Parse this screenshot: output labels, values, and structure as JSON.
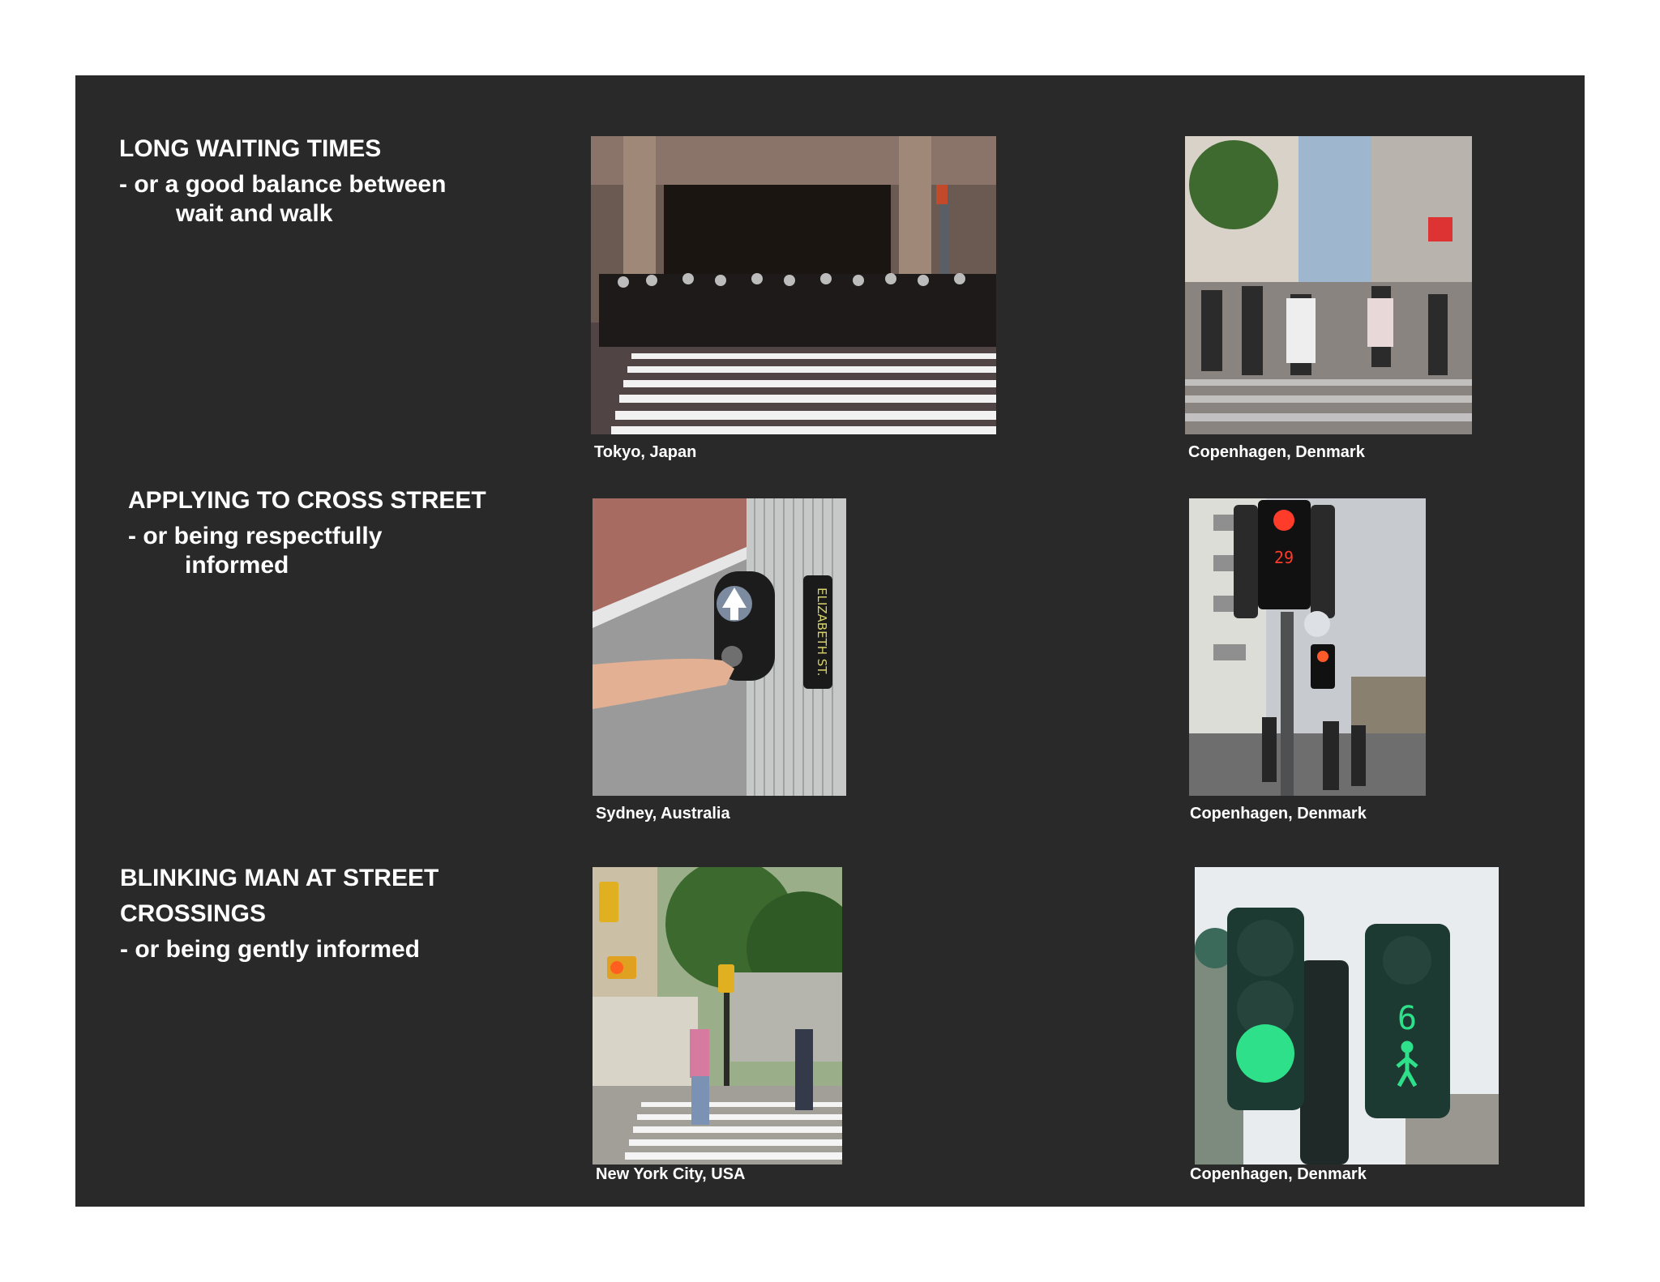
{
  "sections": [
    {
      "title": "LONG WAITING TIMES",
      "line1": "- or a good balance between",
      "line2": "wait and walk"
    },
    {
      "title": "APPLYING TO CROSS STREET",
      "line1": "- or being respectfully",
      "line2": "informed"
    },
    {
      "title_line1": "BLINKING MAN  AT STREET",
      "title_line2": "CROSSINGS",
      "line1": "- or being gently informed"
    }
  ],
  "captions": {
    "tokyo": "Tokyo, Japan",
    "copenhagen_1": "Copenhagen, Denmark",
    "sydney": "Sydney, Australia",
    "copenhagen_2": "Copenhagen, Denmark",
    "nyc": "New York City, USA",
    "copenhagen_3": "Copenhagen, Denmark"
  },
  "signals": {
    "countdown_red": "29",
    "countdown_green": "6",
    "street_sign": "ELIZABETH ST."
  },
  "colors": {
    "panel": "#29292a",
    "text": "#ffffff",
    "signal_red": "#ff3b2a",
    "signal_green": "#2ee08a"
  }
}
